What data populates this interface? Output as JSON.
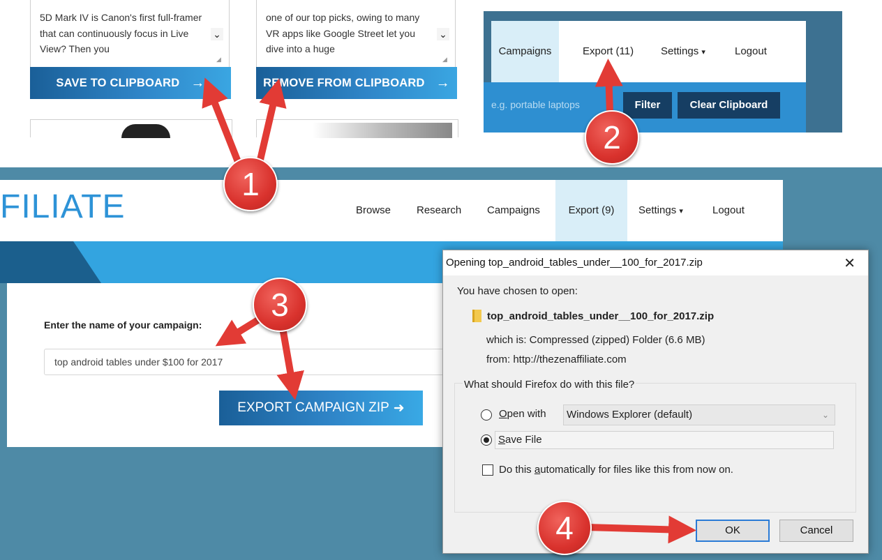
{
  "cards": [
    {
      "text": "5D Mark IV is Canon's first full-framer that can continuously focus in Live View? Then you",
      "button": "SAVE TO CLIPBOARD",
      "button_arrow": "→"
    },
    {
      "text": "one of our top picks, owing to many VR apps like Google Street let you dive into a huge",
      "button": "REMOVE FROM CLIPBOARD",
      "button_arrow": "→"
    }
  ],
  "nav_top": {
    "items": [
      "Campaigns",
      "Export (11)",
      "Settings",
      "Logout"
    ],
    "settings_caret": "▾",
    "filter_placeholder": "e.g. portable laptops",
    "filter_button": "Filter",
    "clear_button": "Clear Clipboard"
  },
  "main": {
    "brand": "FILIATE",
    "nav": [
      "Browse",
      "Research",
      "Campaigns",
      "Export (9)",
      "Settings",
      "Logout"
    ],
    "settings_caret": "▾",
    "campaign_label": "Enter the name of your campaign:",
    "campaign_value": "top android tables under $100 for 2017",
    "export_button": "EXPORT CAMPAIGN ZIP",
    "export_arrow": "➜"
  },
  "dialog": {
    "title": "Opening top_android_tables_under__100_for_2017.zip",
    "close": "✕",
    "chosen": "You have chosen to open:",
    "filename": "top_android_tables_under__100_for_2017.zip",
    "which_is": "which is:  Compressed (zipped) Folder (6.6 MB)",
    "from": "from:  http://thezenaffiliate.com",
    "question": "What should Firefox do with this file?",
    "open_with_prefix": "",
    "open_with_u": "O",
    "open_with_rest": "pen with",
    "open_with_app": "Windows Explorer (default)",
    "save_u": "S",
    "save_rest": "ave File",
    "auto_pre": "Do this ",
    "auto_u": "a",
    "auto_rest": "utomatically for files like this from now on.",
    "ok": "OK",
    "cancel": "Cancel"
  },
  "badges": [
    "1",
    "2",
    "3",
    "4"
  ],
  "colors": {
    "accent_blue": "#2e93d7",
    "badge_red": "#d9322d",
    "dark_navy": "#163e63"
  }
}
